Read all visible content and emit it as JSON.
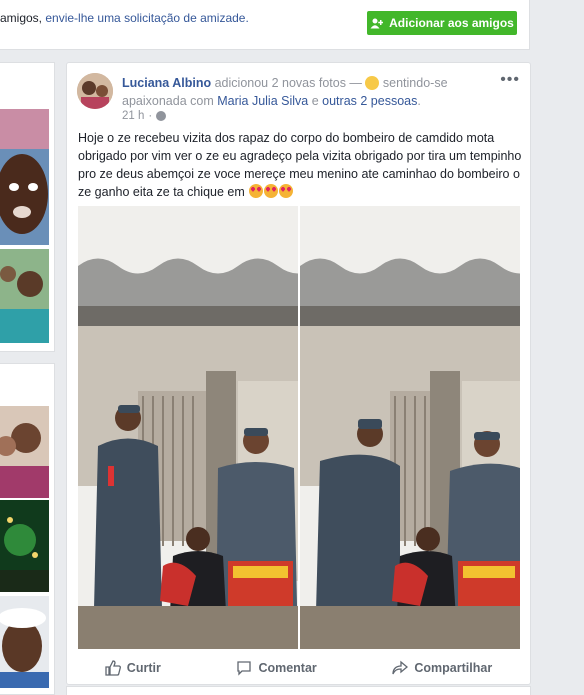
{
  "friend_request_bar": {
    "prefix": "amigos, ",
    "link": "envie-lhe uma solicitação de amizade.",
    "button_label": "Adicionar aos amigos"
  },
  "post": {
    "author": "Luciana Albino",
    "action": "adicionou 2 novas fotos — ",
    "feeling": "sentindo-se apaixonada com",
    "tagged": "Maria Julia Silva",
    "connector": "e",
    "others": "outras 2 pessoas",
    "time": "21 h",
    "separator": "·",
    "text": "Hoje o ze recebeu vizita dos rapaz do corpo do bombeiro de camdido mota obrigado por vim ver o ze eu agradeço pela vizita obrigado por tira um tempinho pro ze deus abemçoi ze voce mereçe meu menino ate caminhao do bombeiro o ze ganho eita ze ta chique em",
    "more_icon": "ellipsis-icon"
  },
  "actions": {
    "like": "Curtir",
    "comment": "Comentar",
    "share": "Compartilhar"
  }
}
